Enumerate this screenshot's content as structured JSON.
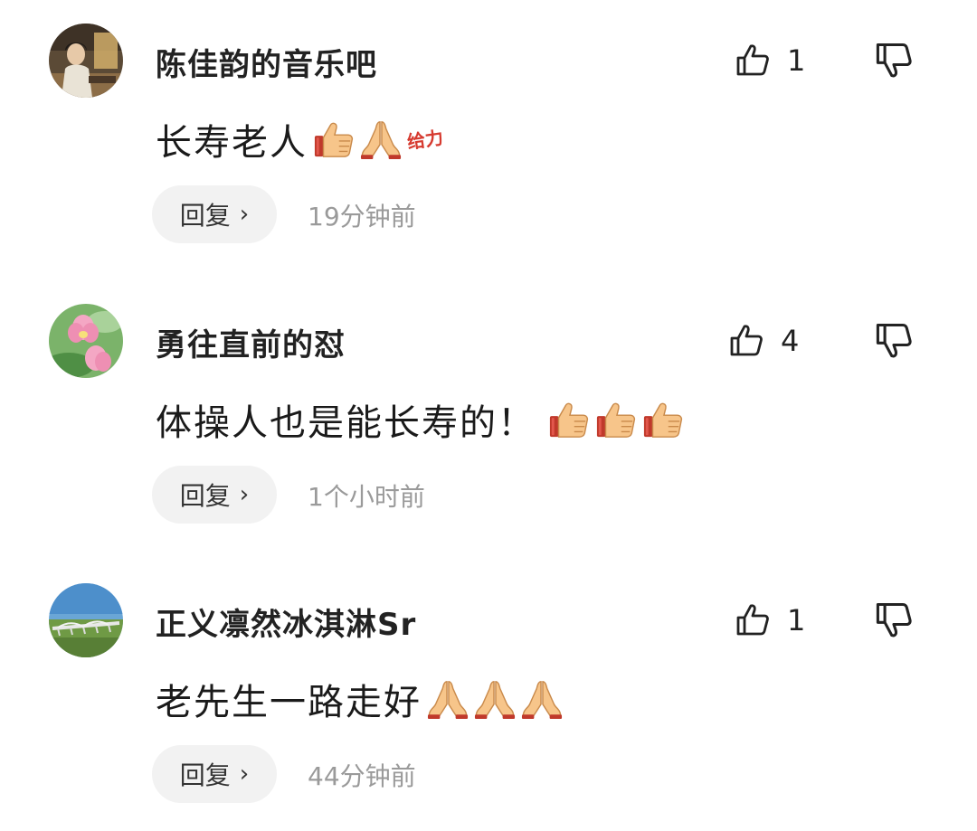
{
  "comments": [
    {
      "username": "陈佳韵的音乐吧",
      "like_count": "1",
      "content": "长寿老人",
      "emojis": [
        "thumbs-up",
        "folded-hands",
        "geili-sticker"
      ],
      "sticker_text": "给力",
      "reply_label": "回复",
      "timestamp": "19分钟前"
    },
    {
      "username": "勇往直前的怼",
      "like_count": "4",
      "content": "体操人也是能长寿的！",
      "emojis": [
        "thumbs-up",
        "thumbs-up",
        "thumbs-up"
      ],
      "reply_label": "回复",
      "timestamp": "1个小时前"
    },
    {
      "username": "正义凛然冰淇淋Sr",
      "like_count": "1",
      "content": "老先生一路走好",
      "emojis": [
        "folded-hands",
        "folded-hands",
        "folded-hands"
      ],
      "reply_label": "回复",
      "timestamp": "44分钟前"
    }
  ]
}
